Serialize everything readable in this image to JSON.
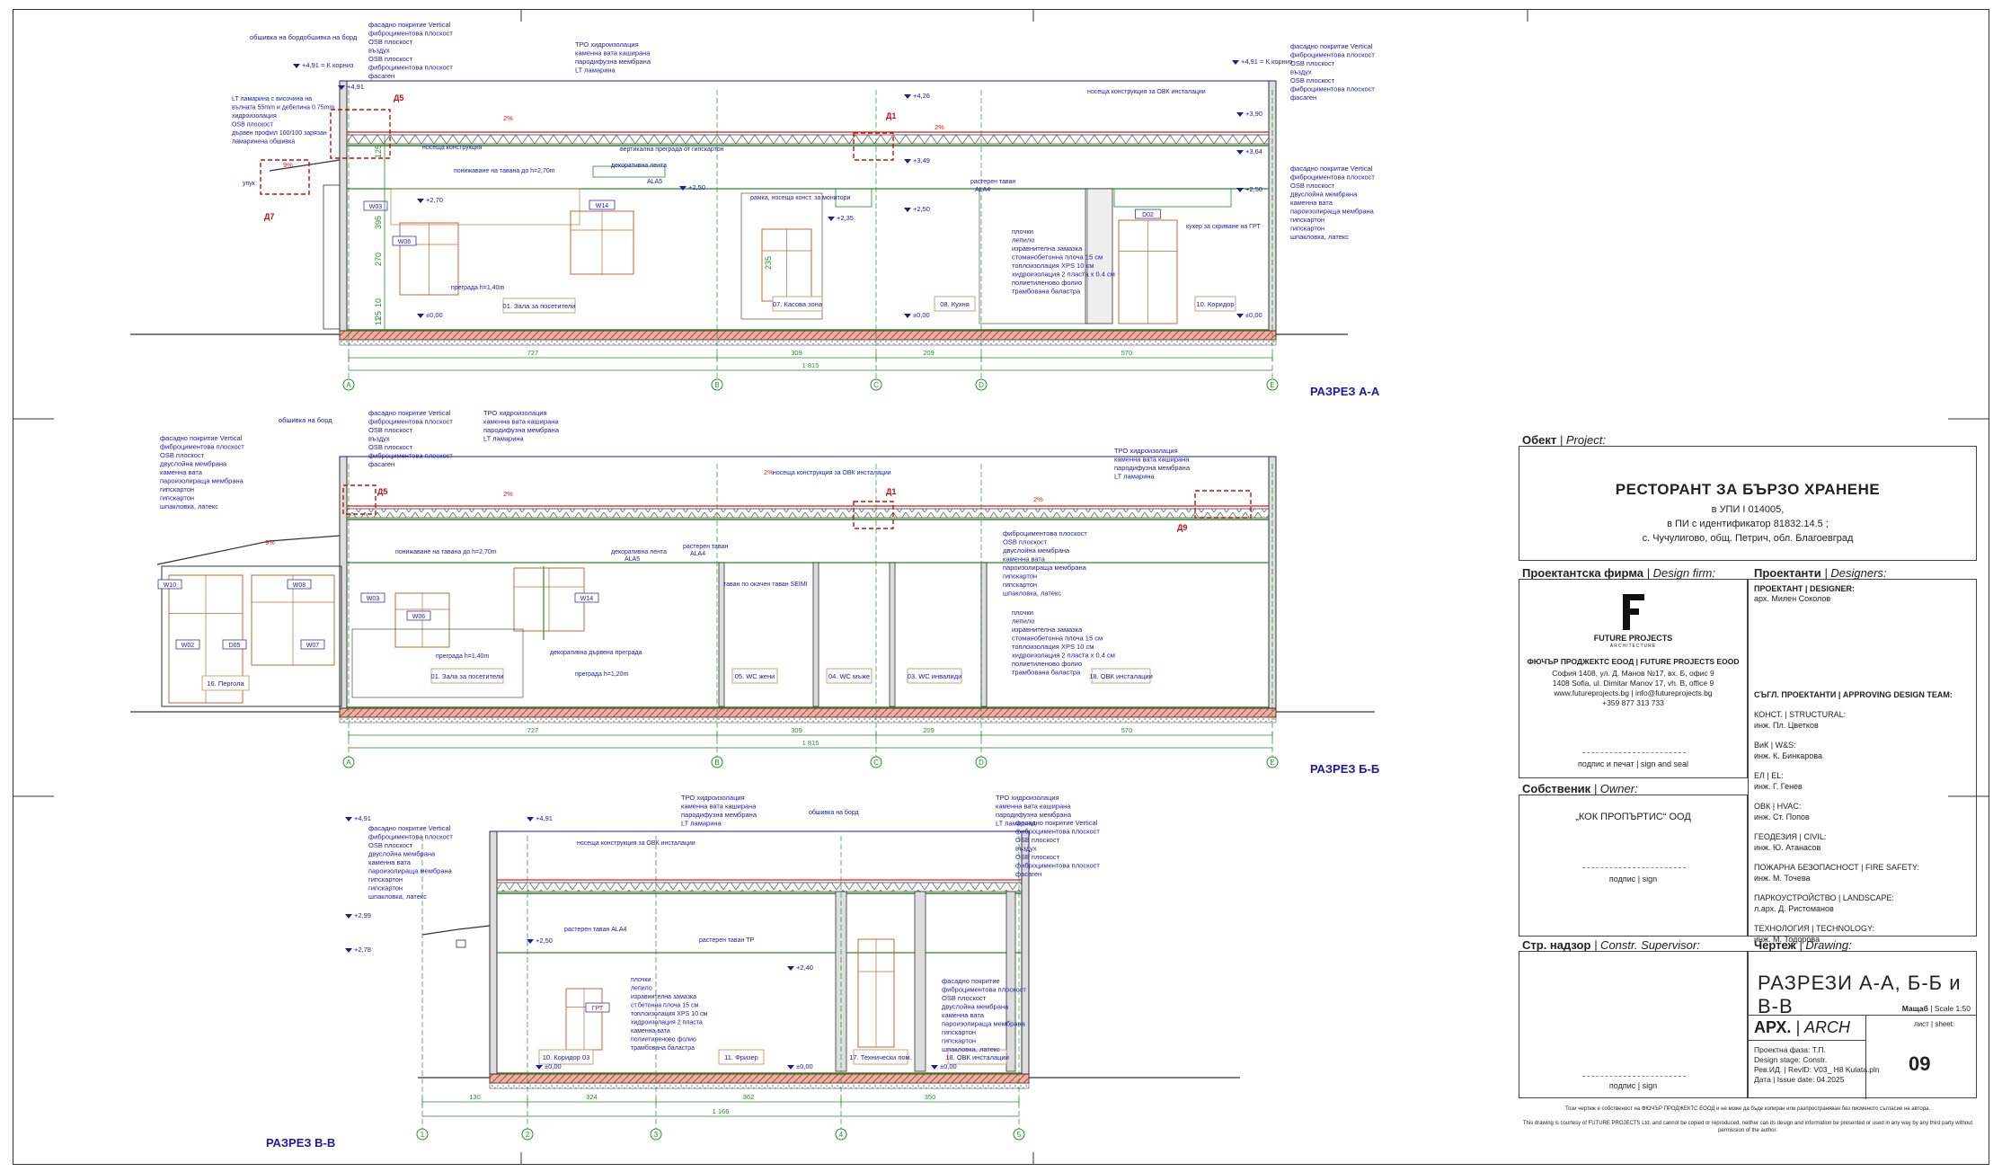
{
  "sections": {
    "aa": {
      "title": "РАЗРЕЗ А-А",
      "notes_left": [
        "обшивка на бордобшивка на борд"
      ],
      "notes_cornice": [
        "фасадно покритие Vertical",
        "фиброциментова плоскост",
        "OSB плоскост",
        "въздух",
        "OSB плоскост",
        "фиброциментова плоскост",
        "фасаген"
      ],
      "notes_roof": [
        "ТРО хидроизолация",
        "каменна вата каширана",
        "пародифузна мембрана",
        "LT ламарина"
      ],
      "notes_right_top": [
        "фасадно покритие Vertical",
        "фиброциментова плоскост",
        "OSB плоскост",
        "въздух",
        "OSB плоскост",
        "фиброциментова плоскост",
        "фасаген"
      ],
      "notes_lt": [
        "LT ламарина с височина на",
        "вълната 55mm и дебелина 0.75mm",
        "хидроизолация",
        "OSB плоскост",
        "дървен профил 100/100 зарязан",
        "ламаринена обшивка"
      ],
      "notes_right_mid": [
        "фасадно покритие Vertical",
        "фиброциментова плоскост",
        "OSB плоскост",
        "двуслойна мембрана",
        "каменна вата",
        "пароизолираща мембрана",
        "гипскартон",
        "гипскартон",
        "шпакловка, латекс"
      ],
      "notes_floor": [
        "плочки",
        "лепило",
        "изравнителна замазка",
        "стоманобетонна плоча 15 см",
        "топлоизолация XPS 10 см",
        "хидроизолация 2 пласта x 0.4 см",
        "полиетиленово фолио",
        "трамбована баластра"
      ],
      "callouts": [
        "Д5",
        "Д7",
        "Д1"
      ],
      "levels": [
        "+4,91 = К корниз",
        "+4,91",
        "+4,26",
        "+3,90",
        "+3,64",
        "+3,49",
        "+2,70",
        "+2,50",
        "+2,50",
        "+2,35",
        "±0,00",
        "±0,00",
        "±0,00",
        "+4,91 = К корниз",
        "+2,50"
      ],
      "slopes": [
        "2%",
        "2%",
        "9%"
      ],
      "labels_misc": [
        "носеща конструкция",
        "понижаване на тавана до h=2,70m",
        "вертикална преграда от гипскартон",
        "декоративна лента",
        "ALA5",
        "растерен таван",
        "ALA4",
        "носеща конструкция за ОВК инсталации",
        "рамка, носеща конст. за монитори",
        "преграда h=1,40m",
        "кухер за скриване на ГРТ",
        "упук"
      ],
      "rooms": [
        "01. Зала за посетители",
        "07. Касова зона",
        "08. Кухня",
        "10. Коридор"
      ],
      "windows": [
        "W03",
        "W06",
        "W14",
        "D02"
      ],
      "dims_v": [
        "125",
        "395",
        "270",
        "25",
        "10",
        "11"
      ],
      "dims_h": [
        "727",
        "309",
        "209",
        "570",
        "1 815",
        "235"
      ],
      "axes": [
        "A",
        "B",
        "C",
        "D",
        "E"
      ]
    },
    "bb": {
      "title": "РАЗРЕЗ Б-Б",
      "notes_left": [
        "обшивка на борд"
      ],
      "notes_cornice": [
        "фасадно покритие Vertical",
        "фиброциментова плоскост",
        "OSB плоскост",
        "въздух",
        "OSB плоскост",
        "фиброциментова плоскост",
        "фасаген"
      ],
      "notes_left2": [
        "фасадно покритие Vertical",
        "фиброциментова плоскост",
        "OSB плоскост",
        "двуслойна мембрана",
        "каменна вата",
        "пароизолираща мембрана",
        "гипскартон",
        "гипскартон",
        "шпакловка, латекс"
      ],
      "notes_roof": [
        "ТРО хидроизолация",
        "каменна вата каширана",
        "пародифузна мембрана",
        "LT ламарина"
      ],
      "notes_roof2": [
        "ТРО хидроизолация",
        "каменна вата каширана",
        "пародифузна мембрана",
        "LT ламарина"
      ],
      "notes_mid": [
        "фиброциментова плоскост",
        "OSB плоскост",
        "двуслойна мембрана",
        "каменна вата",
        "пароизолираща мембрана",
        "гипскартон",
        "гипскартон",
        "шпакловка, латекс"
      ],
      "notes_floor": [
        "плочки",
        "лепило",
        "изравнителна замазка",
        "стоманобетонна плоча 15 см",
        "топлоизолация XPS 10 см",
        "хидроизолация 2 пласта x 0.4 см",
        "полиетиленово фолио",
        "трамбована баластра"
      ],
      "callouts": [
        "Д5",
        "Д1",
        "Д9"
      ],
      "slopes": [
        "2%",
        "2%",
        "2%",
        "9%"
      ],
      "labels_misc": [
        "носеща конструкция за ОВК инсталации",
        "понижаване на тавана до h=2,70m",
        "декоративна лента",
        "ALA5",
        "растерен таван",
        "ALA4",
        "таван по окачен таван SEIMI",
        "преграда h=1,40m",
        "декоративна дървена преграда",
        "преграда h=1,20m"
      ],
      "rooms": [
        "16. Пергола",
        "01. Зала за посетители",
        "05. WC жени",
        "04. WC мъже",
        "03. WC инвалиди",
        "18. ОВК инсталации"
      ],
      "windows": [
        "W10",
        "W08",
        "W03",
        "W14",
        "W06",
        "W02",
        "D05",
        "W07"
      ],
      "dims_h": [
        "727",
        "309",
        "209",
        "570",
        "1 815"
      ],
      "axes": [
        "A",
        "B",
        "C",
        "D",
        "E"
      ]
    },
    "vv": {
      "title": "РАЗРЕЗ В-В",
      "notes_left": [
        "фасадно покритие Vertical",
        "фиброциментова плоскост",
        "OSB плоскост",
        "двуслойна мембрана",
        "каменна вата",
        "пароизолираща мембрана",
        "гипскартон",
        "гипскартон",
        "шпакловка, латекс"
      ],
      "notes_roof": [
        "ТРО хидроизолация",
        "каменна вата каширана",
        "пародифузна мембрана",
        "LT ламарина"
      ],
      "notes_roof2": [
        "ТРО хидроизолация",
        "каменна вата каширана",
        "пародифузна мембрана",
        "LT ламарина"
      ],
      "notes_right": [
        "фасадно покритие Vertical",
        "фиброциментова плоскост",
        "OSB плоскост",
        "въздух",
        "OSB плоскост",
        "фиброциментова плоскост",
        "фасаген"
      ],
      "notes_wall": [
        "фасадно покритие",
        "фиброциментова плоскост",
        "OSB плоскост",
        "двуслойна мембрана",
        "каменна вата",
        "пароизолираща мембрана",
        "гипскартон",
        "гипскартон",
        "шпакловка, латекс"
      ],
      "notes_floor": [
        "плочки",
        "лепило",
        "изравнителна замазка",
        "ст.бетонна плоча 15 см",
        "топлоизолация XPS 10 см",
        "хидроизолация 2 пласта",
        "каменна вата",
        "полиетиленово фолио",
        "трамбована баластра"
      ],
      "levels": [
        "+4,91",
        "+4,91",
        "+2,99",
        "+2,78",
        "+2,50",
        "+2,40",
        "±0,00",
        "±0,00",
        "±0,00"
      ],
      "labels_misc": [
        "обшивка на борд",
        "носеща конструкция за ОВК инсталации",
        "растерен таван ALA4",
        "растерен таван ТР",
        "ГРТ"
      ],
      "rooms": [
        "10. Коридор 03",
        "11. Фризер",
        "17. Технически пом.",
        "18. ОВК инсталации"
      ],
      "dims_h": [
        "130",
        "324",
        "362",
        "350",
        "1 166"
      ],
      "axes": [
        "1",
        "2",
        "3",
        "4",
        "5"
      ]
    }
  },
  "titleblock": {
    "project_hdr": "Обект",
    "project_hdr_en": "| Project:",
    "project_title": "РЕСТОРАНТ ЗА БЪРЗО ХРАНЕНЕ",
    "project_l1": "в УПИ I 014005,",
    "project_l2": "в ПИ с идентификатор 81832.14.5 ;",
    "project_l3": "с. Чучулигово, общ. Петрич, обл. Благоевград",
    "firm_hdr": "Проектантска фирма",
    "firm_hdr_en": "| Design firm:",
    "designers_hdr": "Проектанти",
    "designers_hdr_en": "| Designers:",
    "firm_logo_name": "FUTURE PROJECTS",
    "firm_logo_sub": "ARCHITECTURE",
    "firm_name": "ФЮЧЪР ПРОДЖЕКТС ЕООД | FUTURE PROJECTS EOOD",
    "firm_addr1": "София 1408, ул. Д. Манов №17, вх. Б, офис 9",
    "firm_addr2": "1408 Sofia, ul. Dimitar Manov 17, vh. B, office 9",
    "firm_web": "www.futureprojects.bg | info@futureprojects.bg",
    "firm_phone": "+359 877 313 733",
    "sign_seal": "подпис и печат | sign and seal",
    "designer_lbl": "ПРОЕКТАНТ | DESIGNER:",
    "designer_name": "арх. Милен Соколов",
    "team_hdr": "СЪГЛ. ПРОЕКТАНТИ | APPROVING DESIGN TEAM:",
    "team": [
      {
        "role": "КОНСТ. | STRUCTURAL:",
        "name": "инж. Пл. Цветков"
      },
      {
        "role": "ВиК | W&S:",
        "name": "инж. К. Бинкарова"
      },
      {
        "role": "ЕЛ | EL:",
        "name": "инж. Г. Генев"
      },
      {
        "role": "ОВК | HVAC:",
        "name": "инж. Ст. Попов"
      },
      {
        "role": "ГЕОДЕЗИЯ | CIVIL:",
        "name": "инж. Ю. Атанасов"
      },
      {
        "role": "ПОЖАРНА БЕЗОПАСНОСТ | FIRE SAFETY:",
        "name": "инж. М. Точева"
      },
      {
        "role": "ПАРКОУСТРОЙСТВО | LANDSCAPE:",
        "name": "л.арх. Д. Ристоманов"
      },
      {
        "role": "ТЕХНОЛОГИЯ | TECHNOLOGY:",
        "name": "инж. М. Тодорова"
      }
    ],
    "owner_hdr": "Собственик",
    "owner_hdr_en": "| Owner:",
    "owner_name": "„КОК ПРОПЪРТИС“ ООД",
    "sign": "подпис | sign",
    "supervisor_hdr": "Стр. надзор",
    "supervisor_hdr_en": "| Constr. Supervisor:",
    "drawing_hdr": "Чертеж",
    "drawing_hdr_en": "| Drawing:",
    "drawing_title": "РАЗРЕЗИ А-А, Б-Б и В-В",
    "scale_lbl": "Мащаб",
    "scale_val": "| Scale 1:50",
    "part": "АРХ.",
    "part_en": "| ARCH",
    "sheet_lbl": "лист | sheet:",
    "sheet_no": "09",
    "phase": "Проектна фаза: Т.П.",
    "stage": "Design stage: Constr.",
    "revision": "Рев.ИД. | RevID: V03_ H8 Kulata.pln",
    "date": "Дата | Issue date: 04.2025",
    "disclaimer1": "Този чертеж е собственост на ФЮЧЪР ПРОДЖЕКТС ЕООД и не може да бъде копиран или разпространяван без писменото съгласие на автора.",
    "disclaimer2": "This drawing is courtesy of FUTURE PROJECTS Ltd. and cannot be copied or reproduced, neither can its design and information be presented or used in any way by any third party without permission of the author."
  }
}
